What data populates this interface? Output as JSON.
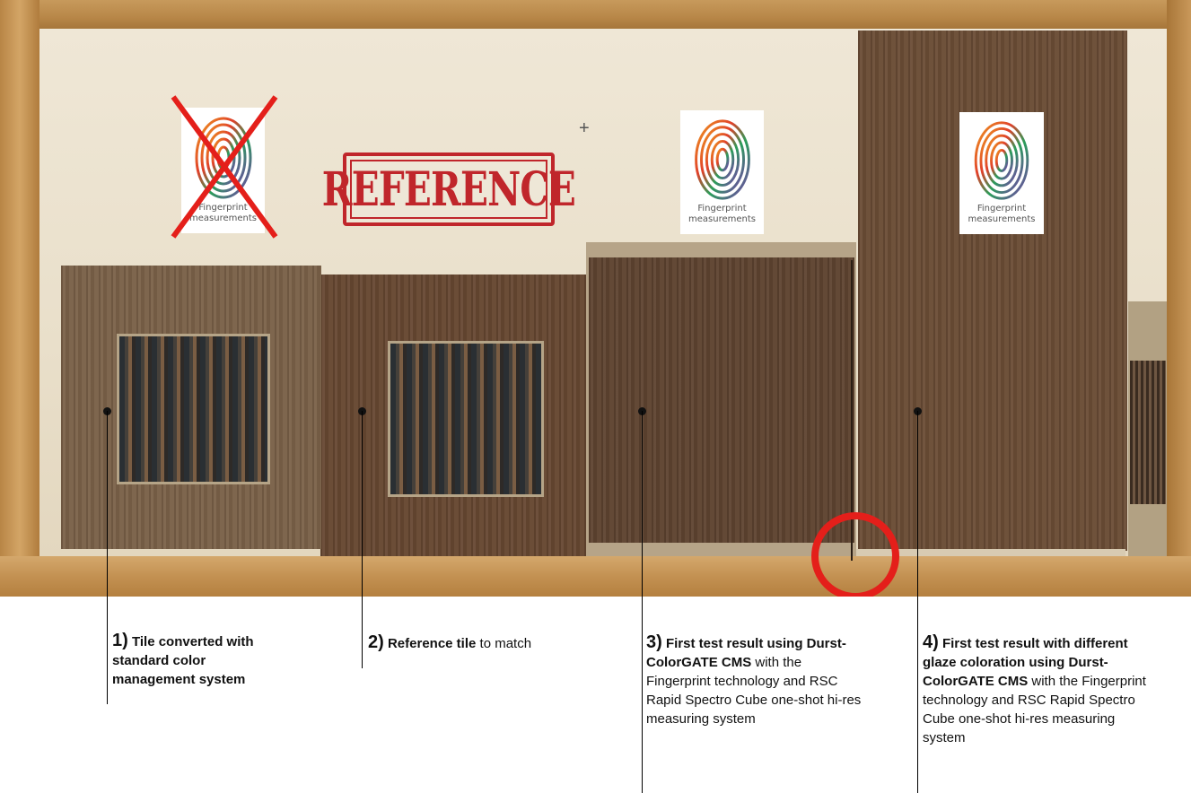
{
  "photo": {
    "stamp_text": "REFERENCE",
    "fingerprint_cards": [
      {
        "line1": "Fingerprint",
        "line2": "measurements",
        "crossed_out": true
      },
      {
        "line1": "Fingerprint",
        "line2": "measurements",
        "crossed_out": false
      },
      {
        "line1": "Fingerprint",
        "line2": "measurements",
        "crossed_out": false
      }
    ],
    "highlight_color": "#e41f1a"
  },
  "captions": [
    {
      "number": "1)",
      "bold": "Tile converted with standard color management system",
      "rest": ""
    },
    {
      "number": "2)",
      "bold": "Reference tile",
      "rest": " to match"
    },
    {
      "number": "3)",
      "bold": "First test result using Durst-ColorGATE CMS",
      "rest": " with the Fingerprint technology and RSC Rapid Spectro Cube one-shot hi-res measuring system"
    },
    {
      "number": "4)",
      "bold": "First test result with different glaze coloration using Durst-ColorGATE CMS",
      "rest": " with the Fingerprint technology and RSC Rapid Spectro Cube one-shot hi-res measuring system"
    }
  ]
}
